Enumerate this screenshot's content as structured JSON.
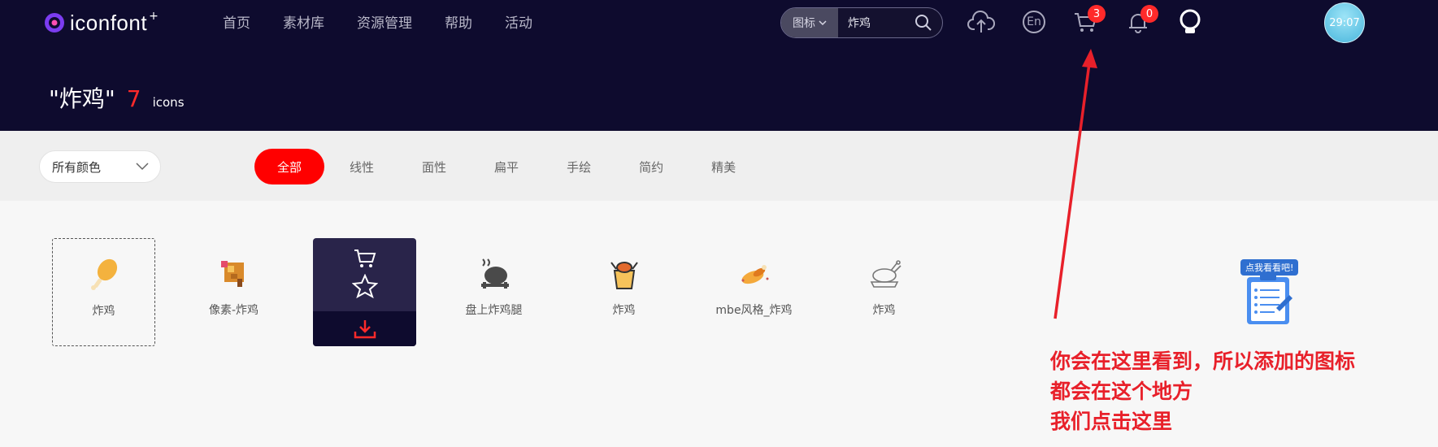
{
  "logo": {
    "text": "iconfont",
    "plus": "+"
  },
  "nav": [
    "首页",
    "素材库",
    "资源管理",
    "帮助",
    "活动"
  ],
  "search": {
    "type": "图标",
    "value": "炸鸡"
  },
  "header_icons": {
    "upload": "cloud-upload-icon",
    "language": "En",
    "cart_badge": "3",
    "notify_badge": "0"
  },
  "avatar_text": "29:07",
  "result": {
    "query": "\"炸鸡\"",
    "count": "7",
    "unit": "icons"
  },
  "filter": {
    "color_select": "所有颜色",
    "styles": [
      "全部",
      "线性",
      "面性",
      "扁平",
      "手绘",
      "简约",
      "精美"
    ]
  },
  "icons": [
    {
      "label": "炸鸡"
    },
    {
      "label": "像素-炸鸡"
    },
    {
      "label": ""
    },
    {
      "label": "盘上炸鸡腿"
    },
    {
      "label": "炸鸡"
    },
    {
      "label": "mbe风格_炸鸡"
    },
    {
      "label": "炸鸡"
    }
  ],
  "promo": {
    "text": "点我看看吧!"
  },
  "annotation": {
    "line1": "你会在这里看到，所以添加的图标",
    "line2": "都会在这个地方",
    "line3": "我们点击这里"
  },
  "colors": {
    "accent": "#ff0000",
    "header_bg": "#0e0b2e",
    "annotation": "#e8202a"
  }
}
